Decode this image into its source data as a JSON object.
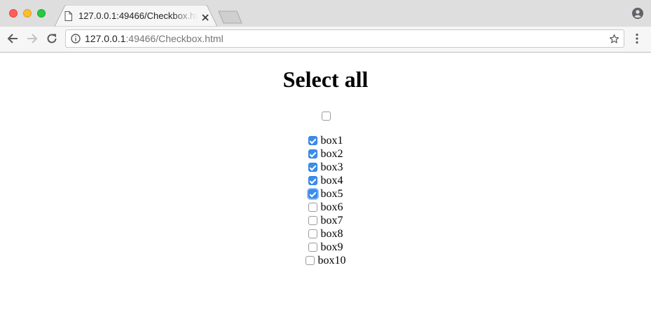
{
  "browser": {
    "tab_title": "127.0.0.1:49466/Checkbox.html",
    "url_host": "127.0.0.1",
    "url_path": ":49466/Checkbox.html"
  },
  "page": {
    "heading": "Select all",
    "select_all_checked": false,
    "boxes": [
      {
        "label": "box1",
        "checked": true,
        "focused": false
      },
      {
        "label": "box2",
        "checked": true,
        "focused": false
      },
      {
        "label": "box3",
        "checked": true,
        "focused": false
      },
      {
        "label": "box4",
        "checked": true,
        "focused": false
      },
      {
        "label": "box5",
        "checked": true,
        "focused": true
      },
      {
        "label": "box6",
        "checked": false,
        "focused": false
      },
      {
        "label": "box7",
        "checked": false,
        "focused": false
      },
      {
        "label": "box8",
        "checked": false,
        "focused": false
      },
      {
        "label": "box9",
        "checked": false,
        "focused": false
      },
      {
        "label": "box10",
        "checked": false,
        "focused": false
      }
    ]
  },
  "colors": {
    "checkbox_checked": "#3b8ded",
    "focus_ring": "#8fbdf7"
  }
}
